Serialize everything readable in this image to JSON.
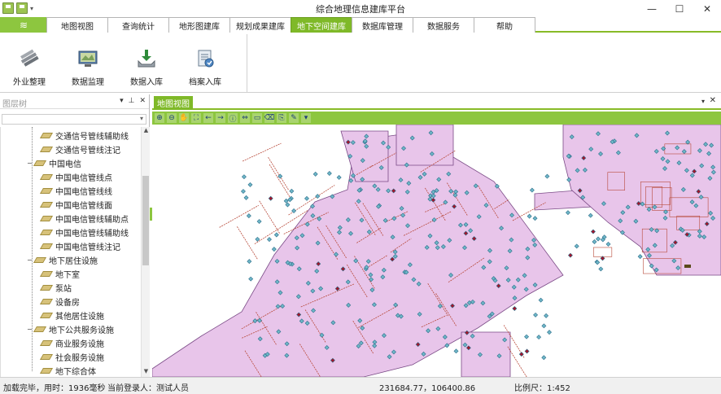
{
  "window": {
    "title": "综合地理信息建库平台",
    "controls": {
      "minimize": "—",
      "maximize": "☐",
      "close": "✕"
    },
    "qat_dropdown": "▾"
  },
  "menu": {
    "home_icon": "≋",
    "tabs": [
      {
        "label": "地图视图"
      },
      {
        "label": "查询统计"
      },
      {
        "label": "地形图建库"
      },
      {
        "label": "规划成果建库"
      },
      {
        "label": "地下空间建库",
        "active": true
      },
      {
        "label": "数据库管理"
      },
      {
        "label": "数据服务"
      },
      {
        "label": "帮助"
      }
    ],
    "accent": "#7fb928"
  },
  "ribbon": {
    "buttons": [
      {
        "label": "外业整理",
        "icon": "pipes-icon"
      },
      {
        "label": "数据监理",
        "icon": "monitor-map-icon"
      },
      {
        "label": "数据入库",
        "icon": "download-tray-icon"
      },
      {
        "label": "档案入库",
        "icon": "archive-document-icon"
      }
    ]
  },
  "layer_panel": {
    "title": "图层树",
    "controls": {
      "menu": "▾",
      "pin": "📌",
      "close": "✕"
    },
    "combo_arrow": "▾",
    "tree": [
      {
        "label": "交通信号管线辅助线",
        "level": 2
      },
      {
        "label": "交通信号管线注记",
        "level": 2
      },
      {
        "label": "中国电信",
        "level": 1,
        "toggle": "−"
      },
      {
        "label": "中国电信管线点",
        "level": 2
      },
      {
        "label": "中国电信管线线",
        "level": 2
      },
      {
        "label": "中国电信管线面",
        "level": 2
      },
      {
        "label": "中国电信管线辅助点",
        "level": 2
      },
      {
        "label": "中国电信管线辅助线",
        "level": 2
      },
      {
        "label": "中国电信管线注记",
        "level": 2
      },
      {
        "label": "地下居住设施",
        "level": 1,
        "toggle": "−"
      },
      {
        "label": "地下室",
        "level": 2
      },
      {
        "label": "泵站",
        "level": 2
      },
      {
        "label": "设备房",
        "level": 2
      },
      {
        "label": "其他居住设施",
        "level": 2
      },
      {
        "label": "地下公共服务设施",
        "level": 1,
        "toggle": "−"
      },
      {
        "label": "商业服务设施",
        "level": 2
      },
      {
        "label": "社会服务设施",
        "level": 2
      },
      {
        "label": "地下综合体",
        "level": 2
      }
    ]
  },
  "map_view": {
    "tab_label": "地图视图",
    "dropdown": "▾",
    "close": "✕",
    "tools": [
      "zoom-in-icon",
      "zoom-out-icon",
      "pan-hand-icon",
      "full-extent-icon",
      "back-arrow-icon",
      "forward-arrow-icon",
      "identify-icon",
      "measure-icon",
      "select-icon",
      "clear-select-icon",
      "export-icon",
      "paint-icon",
      "more-icon"
    ],
    "colors": {
      "parcel_fill": "#e8c5ea",
      "parcel_stroke": "#7a4a86",
      "pipeline": "#b84a3a",
      "node": "#2c6e8a",
      "node_fill": "#6fb7c8"
    }
  },
  "status_bar": {
    "load_status": "加载完毕，用时：1936毫秒",
    "user": "当前登录人：测试人员",
    "coordinates": "231684.77，106400.86",
    "scale": "比例尺：1:452"
  }
}
